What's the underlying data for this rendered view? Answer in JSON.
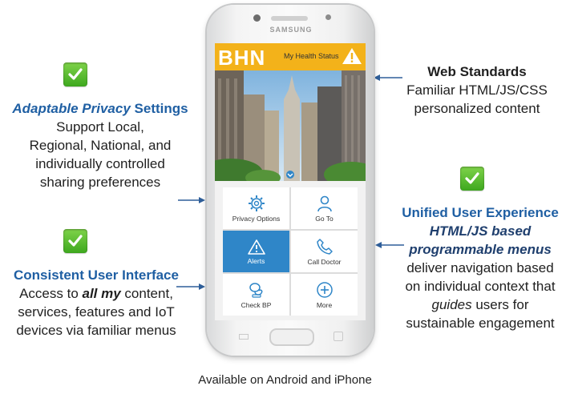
{
  "left_top": {
    "title_italic": "Adaptable Privacy",
    "title_rest": " Settings",
    "lines": [
      "Support Local,",
      "Regional, National, and",
      "individually controlled",
      "sharing preferences"
    ]
  },
  "left_bottom": {
    "title": "Consistent User Interface",
    "line1_pre": "Access to ",
    "line1_em": "all my",
    "line1_post": " content,",
    "line2": "services, features and IoT",
    "line3": "devices via familiar menus"
  },
  "right_top": {
    "title": "Web Standards",
    "lines": [
      "Familiar HTML/JS/CSS",
      "personalized content"
    ]
  },
  "right_bottom": {
    "title": "Unified User Experience",
    "em1": "HTML/JS based",
    "em2": "programmable menus",
    "line3": "deliver navigation based",
    "line4": "on individual context that",
    "line5_em": "guides",
    "line5_post": " users for",
    "line6": "sustainable engagement"
  },
  "phone": {
    "brand": "SAMSUNG",
    "logo": "BHN",
    "status_label": "My Health Status",
    "tiles": [
      {
        "label": "Privacy Options",
        "icon": "gear-icon"
      },
      {
        "label": "Go To",
        "icon": "person-icon"
      },
      {
        "label": "Alerts",
        "icon": "warning-icon"
      },
      {
        "label": "Call Doctor",
        "icon": "phone-icon"
      },
      {
        "label": "Check BP",
        "icon": "blood-pressure-icon"
      },
      {
        "label": "More",
        "icon": "plus-circle-icon"
      }
    ],
    "colors": {
      "header": "#f3b21a",
      "active_tile": "#2f86c8"
    }
  },
  "footer": "Available on Android and iPhone",
  "colors": {
    "check": "#4cb82a",
    "title_blue": "#1f5fa3",
    "arrow": "#2f5f9a"
  }
}
